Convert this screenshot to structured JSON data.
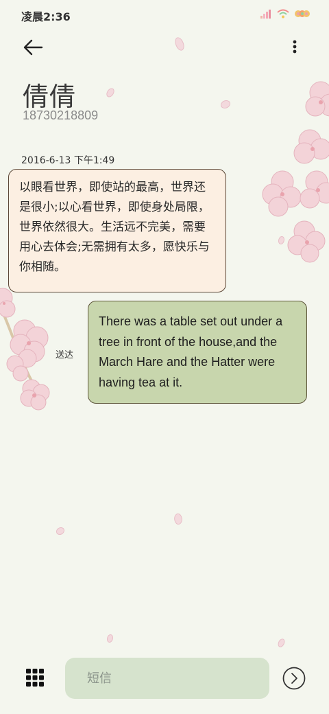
{
  "status_bar": {
    "time": "凌晨2:36",
    "signal_icon": "signal-bars-icon",
    "wifi_icon": "wifi-icon",
    "battery_icon": "battery-icon"
  },
  "header": {
    "back_icon": "arrow-left-icon",
    "more_icon": "more-vertical-icon"
  },
  "contact": {
    "name": "倩倩",
    "number": "18730218809"
  },
  "conversation": {
    "date": "2016-6-13 下午1:49",
    "incoming_message": "以眼看世界，即使站的最高，世界还是很小;以心看世界，即使身处局限，世界依然很大。生活远不完美，需要用心去体会;无需拥有太多，愿快乐与你相随。",
    "outgoing_message": "There was a table set out under a tree in front of the house,and the March Hare and the Hatter were having tea at it.",
    "delivery_status": "送达"
  },
  "composer": {
    "placeholder": "短信",
    "apps_icon": "grid-icon",
    "send_icon": "send-arrow-icon"
  },
  "colors": {
    "background": "#f4f6ee",
    "incoming_bubble": "#fcefe2",
    "outgoing_bubble": "#c8d6ad",
    "input_background": "#d6e3cd"
  }
}
